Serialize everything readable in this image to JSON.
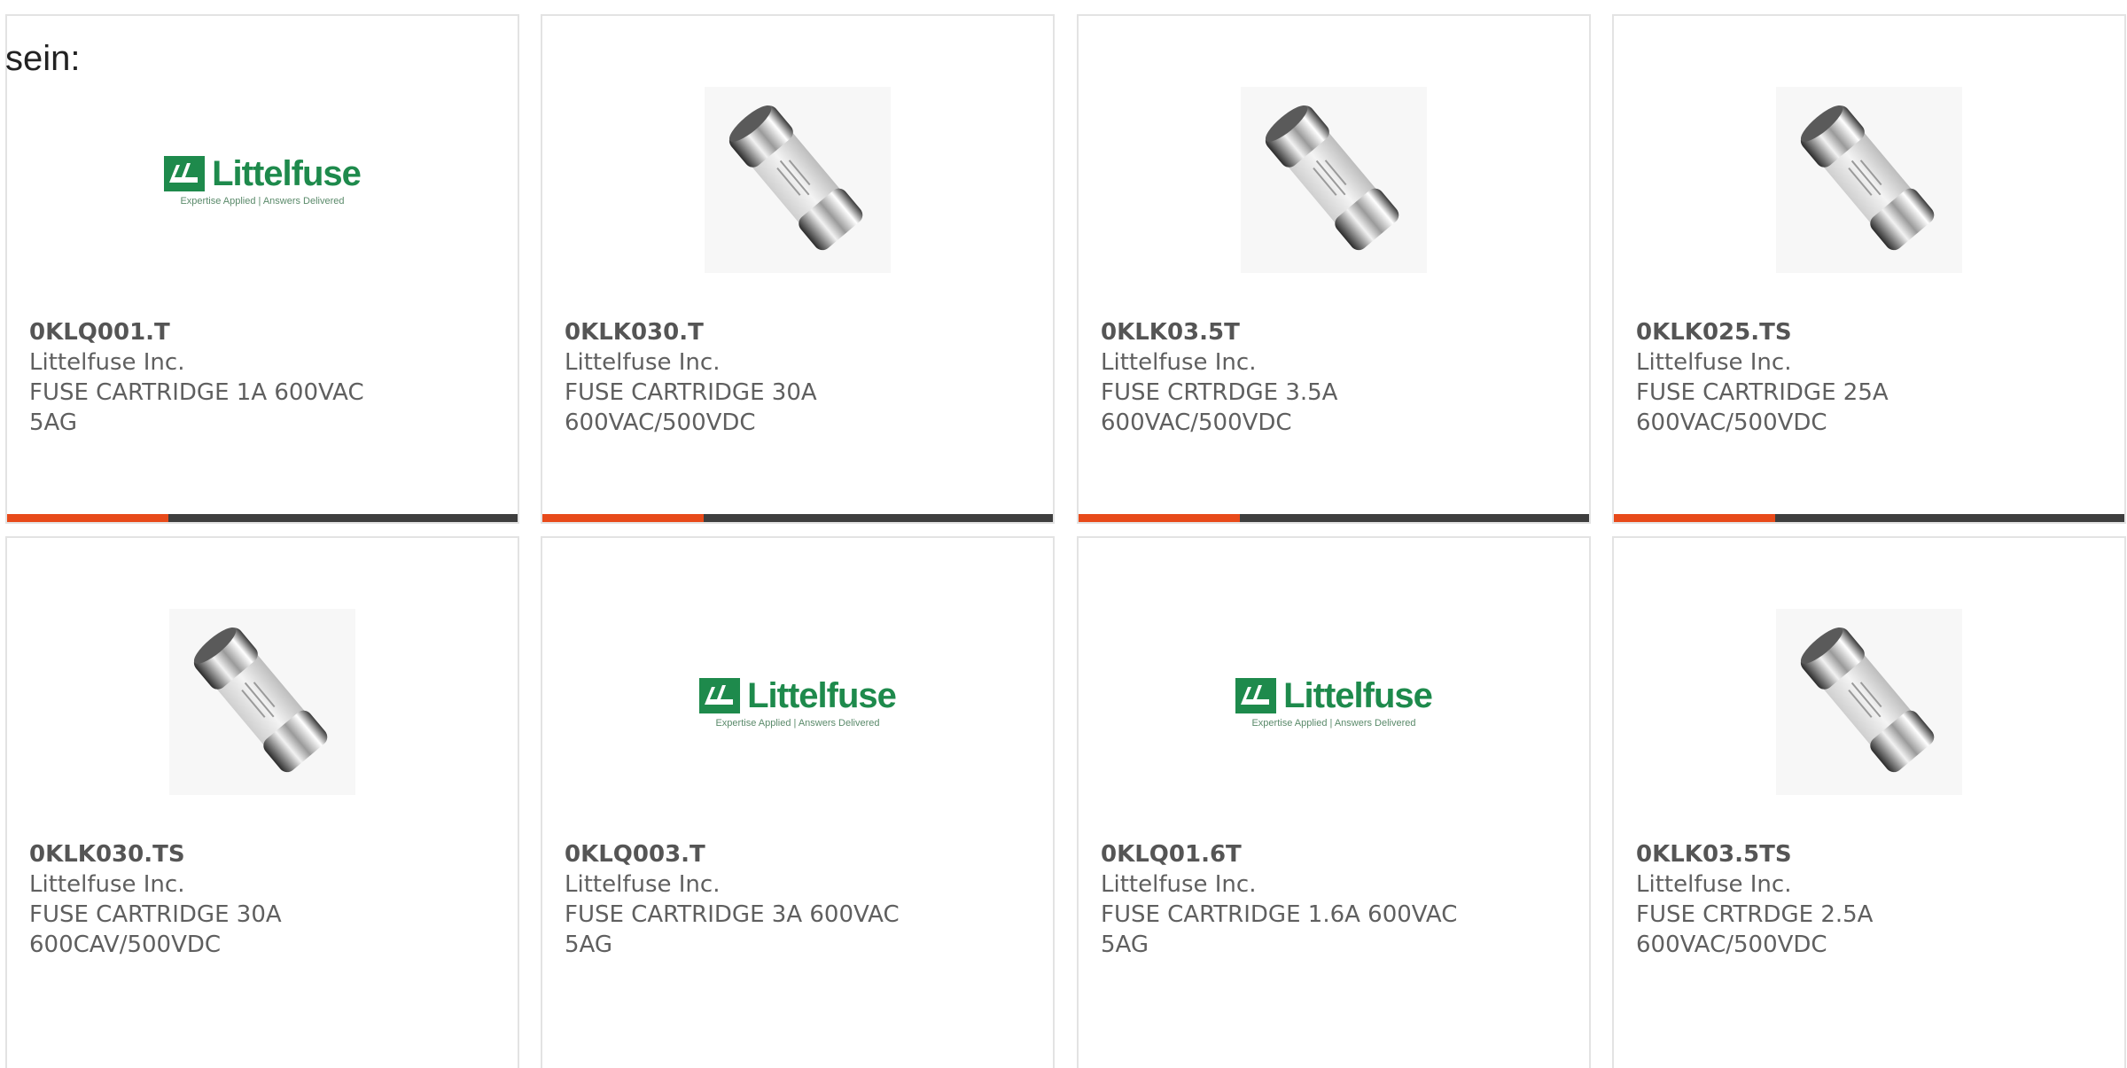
{
  "caption": "sein:",
  "colors": {
    "accent": "#e84a1a",
    "bar": "#3e3e3e",
    "brand_green": "#1e8a4c"
  },
  "logo": {
    "wordmark": "Littelfuse",
    "tagline": "Expertise Applied | Answers Delivered"
  },
  "products": [
    {
      "image": "logo",
      "part": "0KLQ001.T",
      "maker": "Littelfuse Inc.",
      "desc_line1": "FUSE CARTRIDGE 1A 600VAC",
      "desc_line2": "5AG"
    },
    {
      "image": "fuse",
      "part": "0KLK030.T",
      "maker": "Littelfuse Inc.",
      "desc_line1": "FUSE CARTRIDGE 30A",
      "desc_line2": "600VAC/500VDC"
    },
    {
      "image": "fuse",
      "part": "0KLK03.5T",
      "maker": "Littelfuse Inc.",
      "desc_line1": "FUSE CRTRDGE 3.5A",
      "desc_line2": "600VAC/500VDC"
    },
    {
      "image": "fuse",
      "part": "0KLK025.TS",
      "maker": "Littelfuse Inc.",
      "desc_line1": "FUSE CARTRIDGE 25A",
      "desc_line2": "600VAC/500VDC"
    },
    {
      "image": "fuse",
      "part": "0KLK030.TS",
      "maker": "Littelfuse Inc.",
      "desc_line1": "FUSE CARTRIDGE 30A",
      "desc_line2": "600CAV/500VDC"
    },
    {
      "image": "logo",
      "part": "0KLQ003.T",
      "maker": "Littelfuse Inc.",
      "desc_line1": "FUSE CARTRIDGE 3A 600VAC",
      "desc_line2": "5AG"
    },
    {
      "image": "logo",
      "part": "0KLQ01.6T",
      "maker": "Littelfuse Inc.",
      "desc_line1": "FUSE CARTRIDGE 1.6A 600VAC",
      "desc_line2": "5AG"
    },
    {
      "image": "fuse",
      "part": "0KLK03.5TS",
      "maker": "Littelfuse Inc.",
      "desc_line1": "FUSE CRTRDGE 2.5A",
      "desc_line2": "600VAC/500VDC"
    }
  ]
}
